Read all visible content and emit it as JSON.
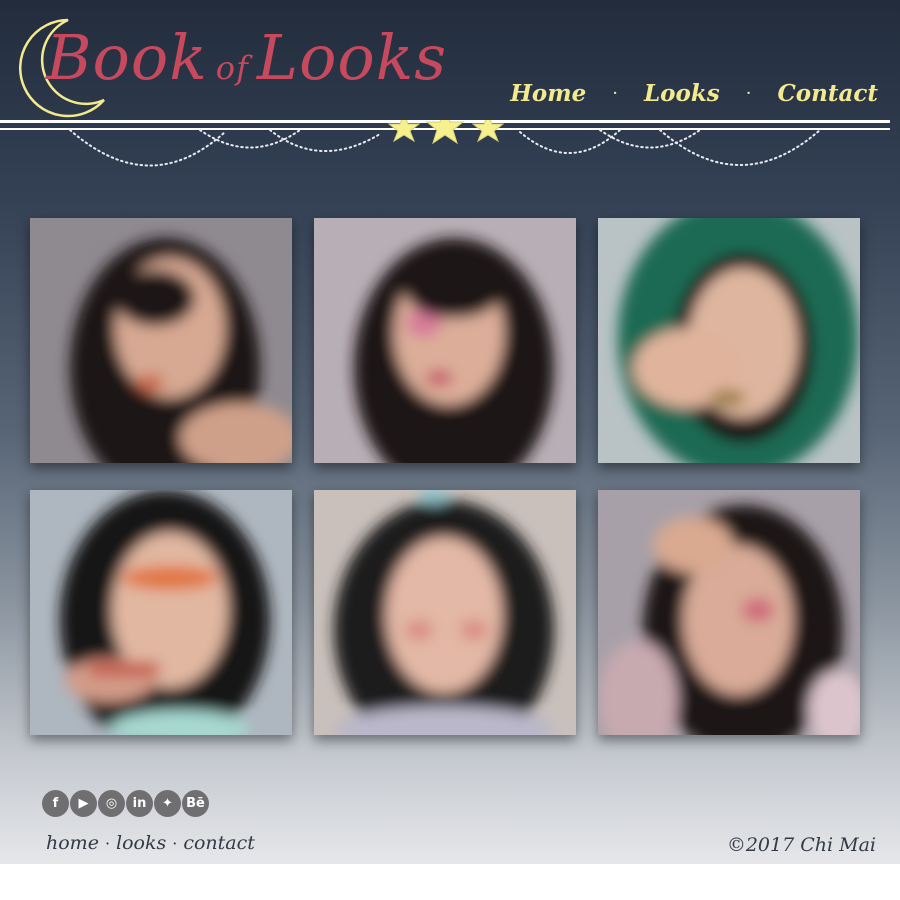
{
  "header": {
    "logo_word1": "Book",
    "logo_word2": "of",
    "logo_word3": "Looks",
    "nav": [
      {
        "label": "Home"
      },
      {
        "label": "Looks"
      },
      {
        "label": "Contact"
      }
    ],
    "nav_separator": "·"
  },
  "gallery": {
    "photos": [
      {
        "name": "look-1",
        "background": "#8f8a90",
        "hair": "#1d1718",
        "skin": "#d7a993",
        "accent": "#c96a4a"
      },
      {
        "name": "look-2",
        "background": "#b8aeb5",
        "hair": "#1c1618",
        "skin": "#dcae99",
        "accent": "#d77a9a"
      },
      {
        "name": "look-3",
        "background": "#1f6b52",
        "hair": "#1a1618",
        "skin": "#deb69f",
        "accent": "#9a7b3a"
      },
      {
        "name": "look-4",
        "background": "#aeb6bf",
        "hair": "#151315",
        "skin": "#e1b7a1",
        "accent": "#e2743f"
      },
      {
        "name": "look-5",
        "background": "#c9c0bb",
        "hair": "#1e1a1b",
        "skin": "#e3b8a6",
        "accent": "#d98c82"
      },
      {
        "name": "look-6",
        "background": "#a7a0a8",
        "hair": "#1a1718",
        "skin": "#d9ab98",
        "accent": "#cf6b7a"
      }
    ]
  },
  "footer": {
    "social": [
      {
        "icon": "facebook-icon",
        "glyph": "f"
      },
      {
        "icon": "youtube-icon",
        "glyph": "▶"
      },
      {
        "icon": "instagram-icon",
        "glyph": "◎"
      },
      {
        "icon": "linkedin-icon",
        "glyph": "in"
      },
      {
        "icon": "twitter-icon",
        "glyph": "✦"
      },
      {
        "icon": "behance-icon",
        "glyph": "Bē"
      }
    ],
    "links": [
      {
        "label": "home"
      },
      {
        "label": "looks"
      },
      {
        "label": "contact"
      }
    ],
    "link_separator": "·",
    "copyright": "©2017 Chi Mai"
  },
  "colors": {
    "brand_pink": "#c7495d",
    "nav_yellow": "#f3ea8e",
    "star_yellow": "#f6f18e"
  }
}
